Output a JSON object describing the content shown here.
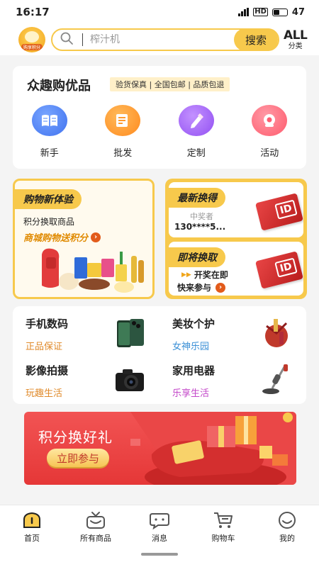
{
  "status": {
    "time": "16:17",
    "network": "HD",
    "battery": "47"
  },
  "header": {
    "logo_text": "购享积分",
    "search_placeholder": "榨汁机",
    "search_button": "搜索",
    "all_label": "ALL",
    "category_label": "分类"
  },
  "featured": {
    "title": "众趣购优品",
    "tags": "验货保真 | 全国包邮 | 品质包退",
    "items": [
      {
        "label": "新手",
        "icon": "book-icon",
        "color": "#4f86f7"
      },
      {
        "label": "批发",
        "icon": "package-icon",
        "color": "#ff9a2e"
      },
      {
        "label": "定制",
        "icon": "pencil-icon",
        "color": "#a463f5"
      },
      {
        "label": "活动",
        "icon": "gift-icon",
        "color": "#ff5b6f"
      }
    ]
  },
  "promo": {
    "new_title": "购物新体验",
    "new_sub1": "积分换取商品",
    "new_sub2": "商城购物送积分",
    "latest_title": "最新换得",
    "winner_label": "中奖者",
    "winner_number": "130****5...",
    "soon_title": "即将换取",
    "soon_line1": "开奖在即",
    "soon_line2": "快来参与"
  },
  "categories": [
    {
      "name": "手机数码",
      "tag": "正品保证",
      "tag_color": "#e08a2a",
      "image": "phone-image"
    },
    {
      "name": "美妆个护",
      "tag": "女神乐园",
      "tag_color": "#3a8fd6",
      "image": "cosmetics-image"
    },
    {
      "name": "影像拍摄",
      "tag": "玩趣生活",
      "tag_color": "#e08a2a",
      "image": "camera-image"
    },
    {
      "name": "家用电器",
      "tag": "乐享生活",
      "tag_color": "#c347c9",
      "image": "vacuum-image"
    }
  ],
  "banner": {
    "title": "积分换好礼",
    "button": "立即参与"
  },
  "tabbar": [
    {
      "label": "首页",
      "icon": "home-icon",
      "active": true
    },
    {
      "label": "所有商品",
      "icon": "tv-icon",
      "active": false
    },
    {
      "label": "消息",
      "icon": "message-icon",
      "active": false
    },
    {
      "label": "购物车",
      "icon": "cart-icon",
      "active": false
    },
    {
      "label": "我的",
      "icon": "smile-icon",
      "active": false
    }
  ],
  "colors": {
    "accent": "#f7c94c",
    "banner_red": "#e53737"
  }
}
